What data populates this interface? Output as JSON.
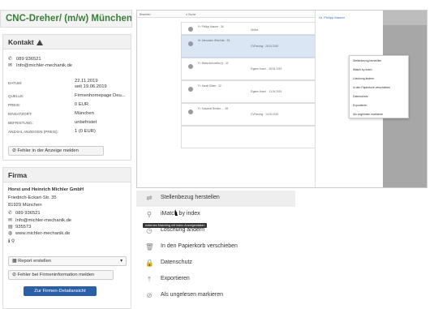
{
  "job": {
    "title": "CNC-Dreher/ (m/w) München"
  },
  "kontakt": {
    "title": "Kontakt",
    "phone": "089 936521",
    "email": "Info@michler-mechanik.de",
    "fields": [
      {
        "label": "DATUM:",
        "value": "22.11.2019",
        "value2": "seit 19.06.2019"
      },
      {
        "label": "QUELLE:",
        "value": "Firmenhomepage Deu..."
      },
      {
        "label": "PREIS:",
        "value": "0 EUR"
      },
      {
        "label": "EINSATZORT:",
        "value": "München"
      },
      {
        "label": "BEFRISTUNG:",
        "value": "unbefristet"
      },
      {
        "label": "ANZAHL ANZEIGEN (PREIS):",
        "value": "1 (0 EUR)"
      }
    ],
    "report_button": "Fehler in der Anzeige melden"
  },
  "firma": {
    "title": "Firma",
    "name": "Horst und Heinrich Michler GmbH",
    "street": "Friedrich-Eckart-Str. 35",
    "city": "81929 München",
    "phone": "089 936521",
    "email": "Info@michler-mechanik.de",
    "fax": "935573",
    "web": "www.michler-mechanik.de",
    "icons_row": "ℹ  ⚲",
    "report_select": "Report erstellen",
    "firm_error_button": "Fehler bei Firmeninformation melden",
    "details_button": "Zur Firmen-Detailansicht"
  },
  "app": {
    "candidates": [
      {
        "name": "Fr. Philipp Maurer · 34",
        "a": "Gesucht",
        "b": "Online",
        "c": "CVParsing · 15.05.2019"
      },
      {
        "name": "Hr. Alexander Wischnik · 34",
        "a": "Gesucht",
        "b": "Online",
        "c": "CVParsing · 28.04.2019"
      },
      {
        "name": "Fr. Maria Antonella (v) · 42",
        "a": "Gesucht",
        "b": "Werkstudent (Anfänger)",
        "c": "Eigene Anzei. · 28.04.2019"
      },
      {
        "name": "Fr. Sarah Ditten · 32",
        "a": "Gesucht",
        "b": "Elektroniker/in (m/w)",
        "c": "Eigene Anzei. · 13.04.2019"
      },
      {
        "name": "Fr. Susanne Brinkm... · 38",
        "a": "Gesucht",
        "b": "Buchhalter/in",
        "c": "CVParsing · 14.05.2019"
      }
    ],
    "profile_name": "Hr. Philipp Maurer",
    "menu_small": [
      "Stellenbezug herstellen",
      "iMatch by Index",
      "Löschung ändern",
      "In den Papierkorb verschieben",
      "Datenschutz",
      "Exportieren",
      "Als ungelesen markieren"
    ]
  },
  "bigmenu": [
    {
      "icon": "link-icon",
      "glyph": "⇌",
      "label": "Stellenbezug herstellen"
    },
    {
      "icon": "search-icon",
      "glyph": "⚲",
      "label": "iMatch by index"
    },
    {
      "icon": "clock-icon",
      "glyph": "◷",
      "label": "Löschung ändern"
    },
    {
      "icon": "trash-icon",
      "glyph": "🗑",
      "label": "In den Papierkorb verschieben"
    },
    {
      "icon": "lock-icon",
      "glyph": "🔒",
      "label": "Datenschutz"
    },
    {
      "icon": "upload-icon",
      "glyph": "⤒",
      "label": "Exportieren"
    },
    {
      "icon": "eye-off-icon",
      "glyph": "⊘",
      "label": "Als ungelesen markieren"
    }
  ],
  "tooltip": "externes Matching mit index Anzeigendaten"
}
